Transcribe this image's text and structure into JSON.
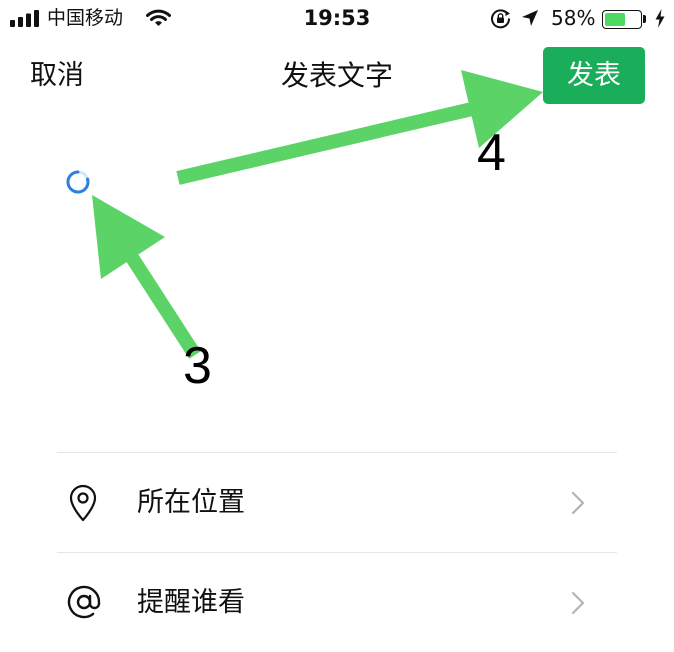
{
  "status_bar": {
    "carrier": "中国移动",
    "time": "19:53",
    "battery_percent": "58%",
    "battery_level": 0.58,
    "icons": [
      "cellular-signal-icon",
      "wifi-icon",
      "rotation-lock-icon",
      "location-arrow-icon",
      "battery-icon",
      "charging-bolt-icon"
    ]
  },
  "nav": {
    "cancel_label": "取消",
    "title": "发表文字",
    "publish_label": "发表"
  },
  "compose": {
    "loading_icon": "loading-spinner-icon"
  },
  "options": [
    {
      "label": "所在位置",
      "icon": "location-pin-icon"
    },
    {
      "label": "提醒谁看",
      "icon": "at-sign-icon"
    }
  ],
  "annotations": [
    {
      "label": "3",
      "points_to": "loading-spinner"
    },
    {
      "label": "4",
      "points_to": "publish-button"
    }
  ],
  "colors": {
    "accent": "#1aad5a",
    "arrow": "#5bd367",
    "spinner": "#2d7fe0"
  }
}
